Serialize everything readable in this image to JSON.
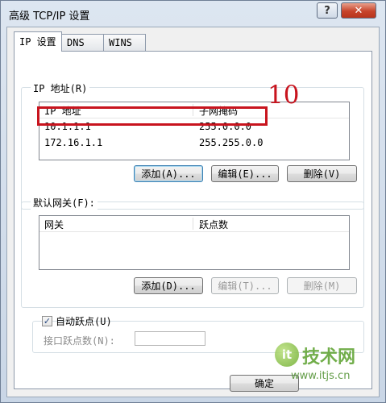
{
  "window": {
    "title": "高级 TCP/IP 设置",
    "help_label": "?",
    "close_label": "✕"
  },
  "tabs": [
    {
      "label": "IP 设置",
      "active": true
    },
    {
      "label": "DNS",
      "active": false
    },
    {
      "label": "WINS",
      "active": false
    }
  ],
  "ip_group": {
    "title": "IP 地址(R)",
    "columns": [
      "IP 地址",
      "子网掩码"
    ],
    "rows": [
      {
        "ip": "10.1.1.1",
        "mask": "255.0.0.0"
      },
      {
        "ip": "172.16.1.1",
        "mask": "255.255.0.0"
      }
    ],
    "buttons": {
      "add": "添加(A)...",
      "edit": "编辑(E)...",
      "delete": "删除(V)"
    }
  },
  "gateway_group": {
    "title": "默认网关(F):",
    "columns": [
      "网关",
      "跃点数"
    ],
    "buttons": {
      "add": "添加(D)...",
      "edit": "编辑(T)...",
      "delete": "删除(M)"
    }
  },
  "metric": {
    "auto_label": "自动跃点(U)",
    "auto_checked": true,
    "interface_label": "接口跃点数(N):",
    "interface_value": ""
  },
  "footer": {
    "ok_label": "确定"
  },
  "annotation": {
    "number": "10",
    "color": "#c8141e"
  },
  "watermark": {
    "brand": "技术网",
    "url": "www.itjs.cn",
    "logo_letter": "it"
  }
}
